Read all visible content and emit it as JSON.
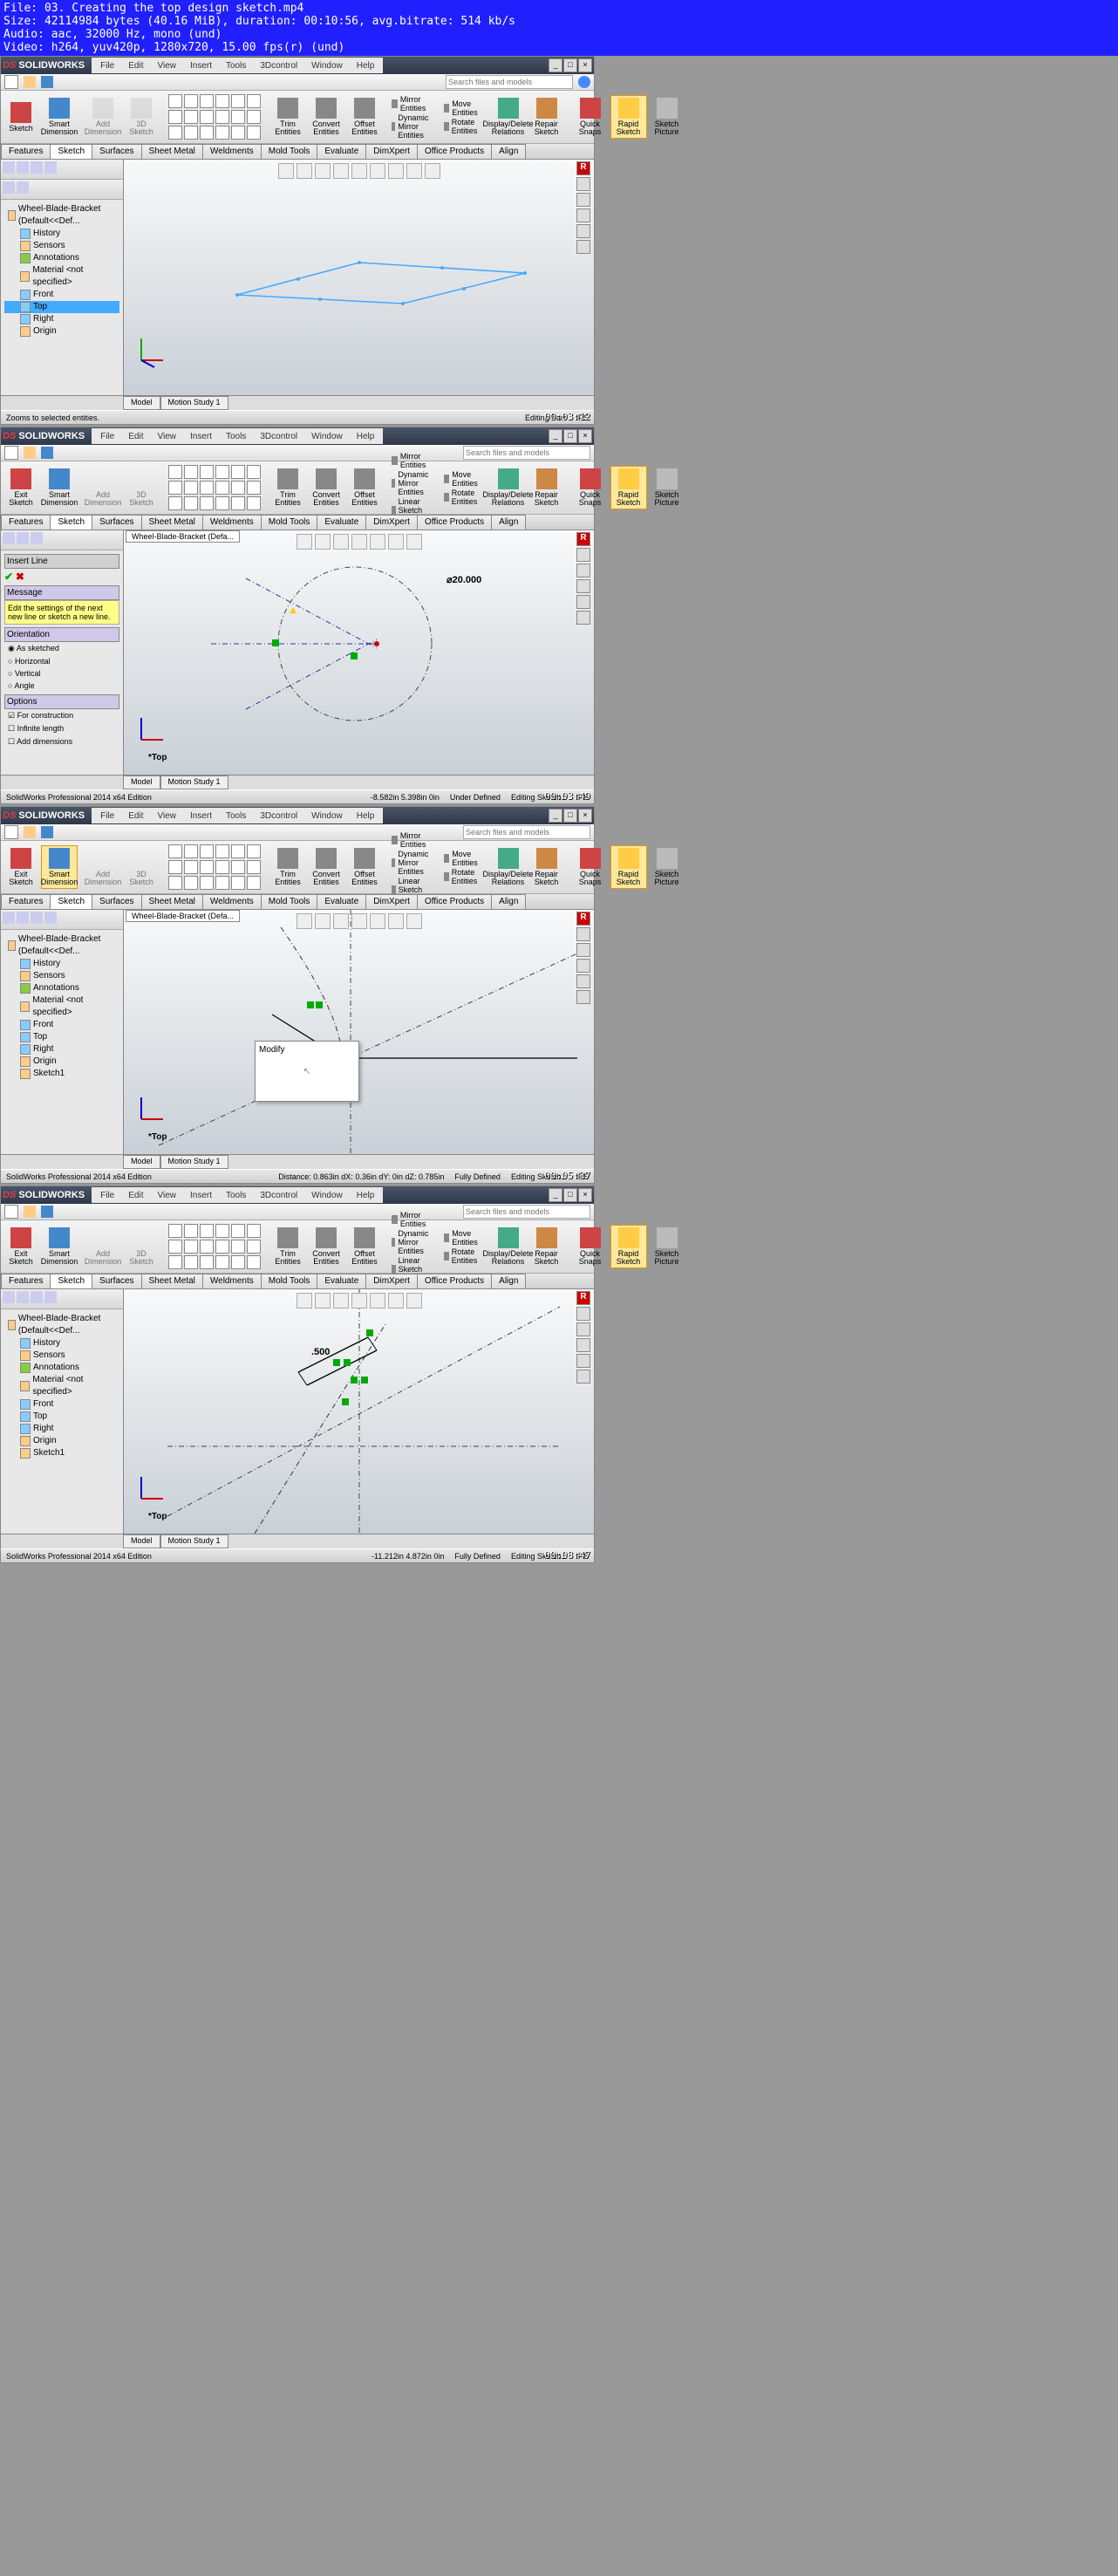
{
  "header_lines": "File: 03. Creating the top design sketch.mp4\nSize: 42114984 bytes (40.16 MiB), duration: 00:10:56, avg.bitrate: 514 kb/s\nAudio: aac, 32000 Hz, mono (und)\nVideo: h264, yuv420p, 1280x720, 15.00 fps(r) (und)",
  "app_name": "SOLIDWORKS",
  "menus": [
    "File",
    "Edit",
    "View",
    "Insert",
    "Tools",
    "3Dcontrol",
    "Window",
    "Help"
  ],
  "search_placeholder": "Search files and models",
  "ribbon": {
    "exit_sketch": "Exit\nSketch",
    "sketch": "Sketch",
    "smart_dimension": "Smart\nDimension",
    "add": "Add\nDimension",
    "three_d_sketch": "3D\nSketch",
    "trim": "Trim\nEntities",
    "convert": "Convert\nEntities",
    "offset": "Offset\nEntities",
    "mirror": "Mirror Entities",
    "dyn_mirror": "Dynamic Mirror Entities",
    "linear_pattern": "Linear Sketch Pattern",
    "move": "Move Entities",
    "rotate": "Rotate Entities",
    "display_delete": "Display/Delete\nRelations",
    "repair": "Repair\nSketch",
    "quick_snaps": "Quick\nSnaps",
    "rapid_sketch": "Rapid\nSketch",
    "sketch_picture": "Sketch\nPicture"
  },
  "feature_tabs": [
    "Features",
    "Sketch",
    "Surfaces",
    "Sheet Metal",
    "Weldments",
    "Mold Tools",
    "Evaluate",
    "DimXpert",
    "Office Products",
    "Align"
  ],
  "tree": {
    "root": "Wheel-Blade-Bracket (Default<<Def...",
    "history": "History",
    "sensors": "Sensors",
    "annotations": "Annotations",
    "material": "Material <not specified>",
    "front": "Front",
    "top": "Top",
    "right": "Right",
    "origin": "Origin",
    "sketch1": "Sketch1"
  },
  "doc_tab": "Wheel-Blade-Bracket (Defa...",
  "insert_line": {
    "title": "Insert Line",
    "msg_hdr": "Message",
    "msg": "Edit the settings of the next new line or sketch a new line.",
    "orientation": "Orientation",
    "as_sketched": "As sketched",
    "horizontal": "Horizontal",
    "vertical": "Vertical",
    "angle": "Angle",
    "options": "Options",
    "for_construction": "For construction",
    "infinite": "Infinite length",
    "add_dims": "Add dimensions"
  },
  "dim_circle": "⌀20.000",
  "dim_500": ".500",
  "modify_title": "Modify",
  "view_top": "*Top",
  "bottom_tabs": {
    "model": "Model",
    "motion": "Motion Study 1"
  },
  "status1": {
    "left": "Zooms to selected entities.",
    "mode": "Editing Part",
    "units": "IPS"
  },
  "status2": {
    "edition": "SolidWorks Professional 2014 x64 Edition",
    "coords": "-8.582in   5.398in   0in",
    "state": "Under Defined",
    "mode": "Editing Sketch1",
    "units": "IPS"
  },
  "status3": {
    "edition": "SolidWorks Professional 2014 x64 Edition",
    "dist": "Distance: 0.863in  dX: 0.36in  dY: 0in  dZ: 0.785in",
    "state": "Fully Defined",
    "mode": "Editing Sketch1",
    "units": "IPS"
  },
  "status4": {
    "edition": "SolidWorks Professional 2014 x64 Edition",
    "coords": "-11.212in   4.872in   0in",
    "state": "Fully Defined",
    "mode": "Editing Sketch1",
    "units": "IPS"
  },
  "timestamps": [
    "00:03:12",
    "00:03:49",
    "00:05:37",
    "00:08:47"
  ]
}
